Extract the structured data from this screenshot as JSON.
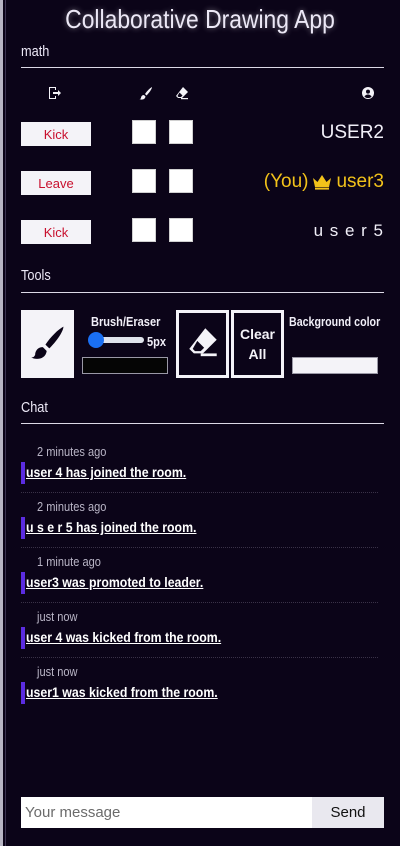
{
  "app": {
    "title": "Collaborative Drawing App"
  },
  "room": {
    "name": "math"
  },
  "users_header": {
    "icons": [
      "leave-room-icon",
      "brush-icon",
      "eraser-icon",
      "user-icon"
    ]
  },
  "users": [
    {
      "action": "Kick",
      "name": "USER2",
      "can_draw": false,
      "can_erase": false,
      "is_you": false,
      "is_leader": false
    },
    {
      "action": "Leave",
      "you_prefix": "(You)",
      "name": "user3",
      "can_draw": false,
      "can_erase": false,
      "is_you": true,
      "is_leader": true
    },
    {
      "action": "Kick",
      "name": "u s e r 5",
      "can_draw": false,
      "can_erase": false,
      "is_you": false,
      "is_leader": false
    }
  ],
  "tools": {
    "label": "Tools",
    "brush_eraser_label": "Brush/Eraser",
    "size_value": "5px",
    "size_fraction": 0.12,
    "brush_color": "#050505",
    "clear_label_line1": "Clear",
    "clear_label_line2": "All",
    "background_label": "Background color",
    "background_color": "#f4f3f8"
  },
  "chat": {
    "label": "Chat",
    "messages": [
      {
        "time": "2 minutes ago",
        "text": "user 4 has joined the room."
      },
      {
        "time": "2 minutes ago",
        "text": "u s e r 5 has joined the room."
      },
      {
        "time": "1 minute ago",
        "text": "user3 was promoted to leader."
      },
      {
        "time": "just now",
        "text": "user 4 was kicked from the room."
      },
      {
        "time": "just now",
        "text": "user1 was kicked from the room."
      }
    ],
    "input_placeholder": "Your message",
    "send_label": "Send"
  },
  "colors": {
    "background": "#0b0418",
    "leader_gold": "#f2c21a",
    "kick_red": "#c8102e",
    "message_accent": "#5b2ce0",
    "slider_blue": "#1a6ff2"
  }
}
